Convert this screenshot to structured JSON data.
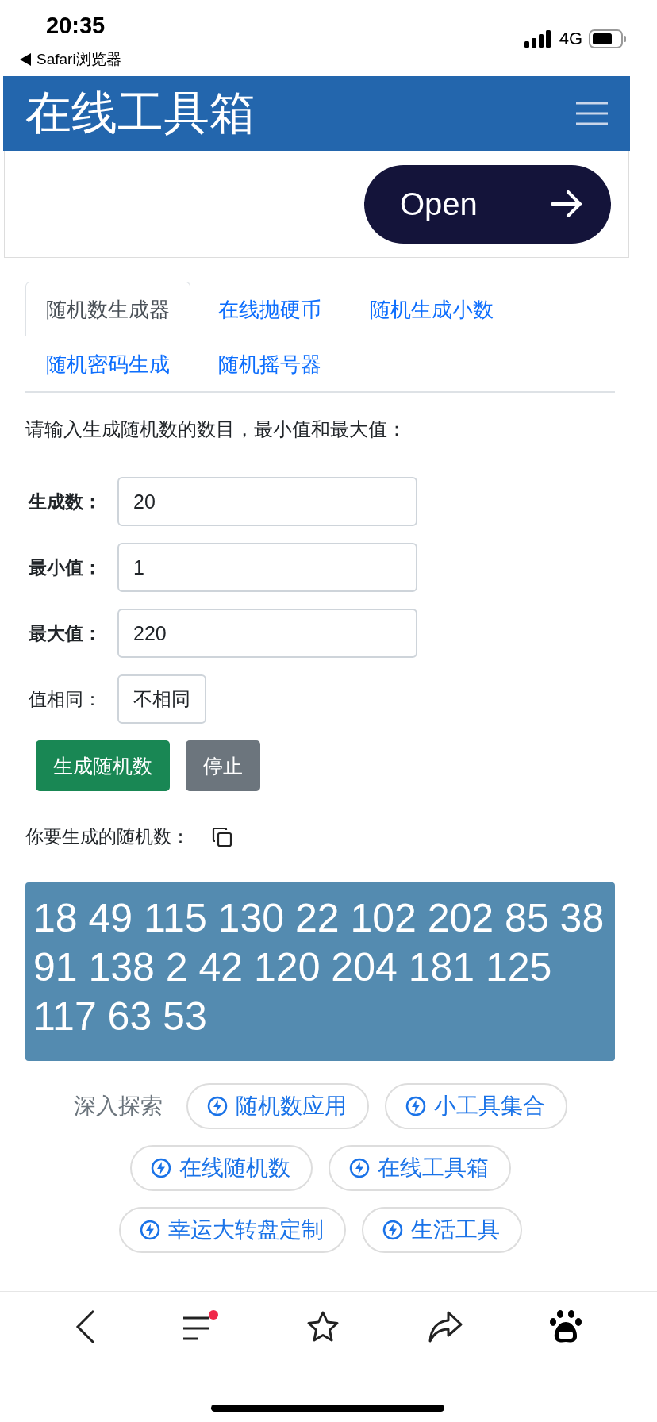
{
  "status_bar": {
    "time": "20:35",
    "back_label": "Safari浏览器",
    "network": "4G"
  },
  "header": {
    "title": "在线工具箱"
  },
  "ad": {
    "button": "Open"
  },
  "tabs": [
    {
      "label": "随机数生成器",
      "selected": true
    },
    {
      "label": "在线抛硬币",
      "selected": false
    },
    {
      "label": "随机生成小数",
      "selected": false
    },
    {
      "label": "随机密码生成",
      "selected": false
    },
    {
      "label": "随机摇号器",
      "selected": false
    }
  ],
  "instruction": "请输入生成随机数的数目，最小值和最大值：",
  "fields": [
    {
      "label": "生成数：",
      "value": "20",
      "kind": "input"
    },
    {
      "label": "最小值：",
      "value": "1",
      "kind": "input"
    },
    {
      "label": "最大值：",
      "value": "220",
      "kind": "input"
    },
    {
      "label": "值相同：",
      "value": "不相同",
      "kind": "select"
    }
  ],
  "buttons": [
    {
      "label": "生成随机数",
      "kind": "primary"
    },
    {
      "label": "停止",
      "kind": "secondary"
    }
  ],
  "result": {
    "label": "你要生成的随机数：",
    "numbers": "18 49 115 130 22 102 202 85 38 91 138 2 42 120 204 181 125 117 63 53"
  },
  "explore": {
    "label": "深入探索",
    "chips": [
      "随机数应用",
      "小工具集合",
      "在线随机数",
      "在线工具箱",
      "幸运大转盘定制",
      "生活工具"
    ]
  },
  "toolbar": {
    "menu_notification": true
  }
}
